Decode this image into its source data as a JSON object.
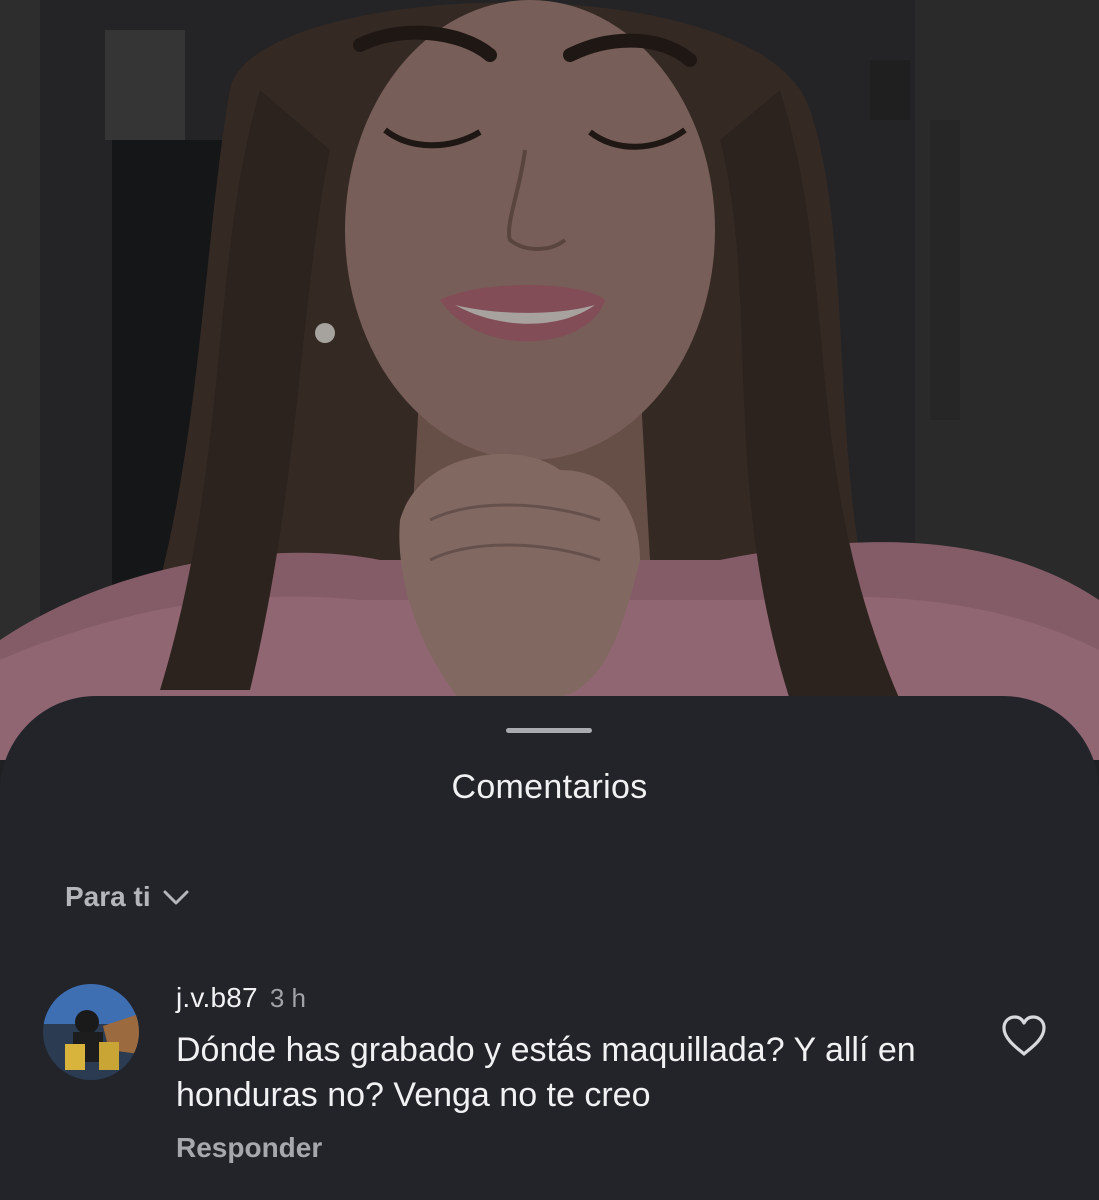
{
  "sheet": {
    "title": "Comentarios",
    "sort_label": "Para ti"
  },
  "comments": [
    {
      "username": "j.v.b87",
      "time": "3 h",
      "text": "Dónde has grabado y estás maquillada? Y allí en honduras no? Venga no te creo",
      "reply_label": "Responder"
    }
  ],
  "icons": {
    "sort": "chevron-down-icon",
    "like": "heart-outline-icon",
    "avatar": "avatar-image"
  },
  "colors": {
    "sheet_background": "#222429",
    "primary_text": "#f1f1f3",
    "secondary_text": "#a6a8ad",
    "sweater_pink": "#e9a0b4"
  }
}
